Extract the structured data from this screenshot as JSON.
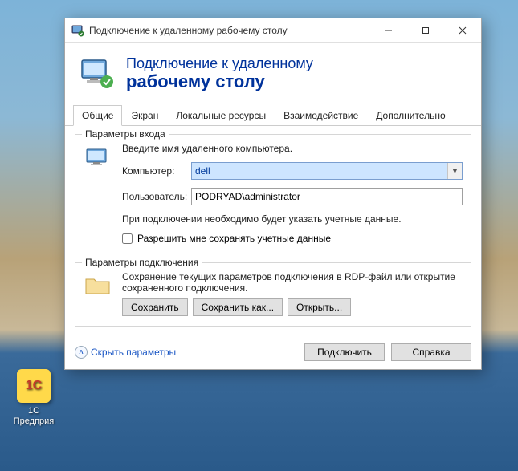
{
  "desktop": {
    "icon_label_1": "1C",
    "icon_label_2": "Предприя"
  },
  "window": {
    "title": "Подключение к удаленному рабочему столу"
  },
  "header": {
    "line1": "Подключение к удаленному",
    "line2": "рабочему столу"
  },
  "tabs": [
    {
      "label": "Общие",
      "active": true
    },
    {
      "label": "Экран"
    },
    {
      "label": "Локальные ресурсы"
    },
    {
      "label": "Взаимодействие"
    },
    {
      "label": "Дополнительно"
    }
  ],
  "login": {
    "legend": "Параметры входа",
    "intro": "Введите имя удаленного компьютера.",
    "computer_label": "Компьютер:",
    "computer_value": "dell",
    "user_label": "Пользователь:",
    "user_value": "PODRYAD\\administrator",
    "note": "При подключении необходимо будет указать учетные данные.",
    "checkbox": "Разрешить мне сохранять учетные данные"
  },
  "conn": {
    "legend": "Параметры подключения",
    "intro": "Сохранение текущих параметров подключения в RDP-файл или открытие сохраненного подключения.",
    "save": "Сохранить",
    "saveas": "Сохранить как...",
    "open": "Открыть..."
  },
  "footer": {
    "hide": "Скрыть параметры",
    "connect": "Подключить",
    "help": "Справка"
  }
}
